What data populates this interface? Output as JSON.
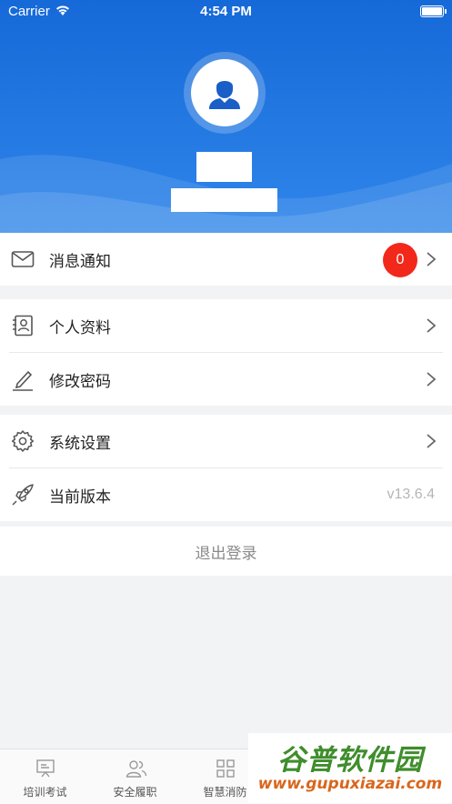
{
  "status_bar": {
    "carrier": "Carrier",
    "time": "4:54 PM"
  },
  "header": {
    "user_name": "",
    "user_info": ""
  },
  "notifications": {
    "label": "消息通知",
    "count": "0"
  },
  "profile": {
    "label": "个人资料"
  },
  "password": {
    "label": "修改密码"
  },
  "settings": {
    "label": "系统设置"
  },
  "version": {
    "label": "当前版本",
    "value": "v13.6.4"
  },
  "logout": {
    "label": "退出登录"
  },
  "tabbar": {
    "tabs": [
      {
        "label": "培训考试"
      },
      {
        "label": "安全履职"
      },
      {
        "label": "智慧消防"
      }
    ]
  },
  "watermark": {
    "brand": "谷普软件园",
    "url": "www.gupuxiazai.com"
  },
  "colors": {
    "header_top": "#1669d8",
    "header_bottom": "#2f86ea",
    "badge": "#f2281b",
    "watermark_green": "#3f8d2c",
    "watermark_orange": "#d9661c"
  }
}
